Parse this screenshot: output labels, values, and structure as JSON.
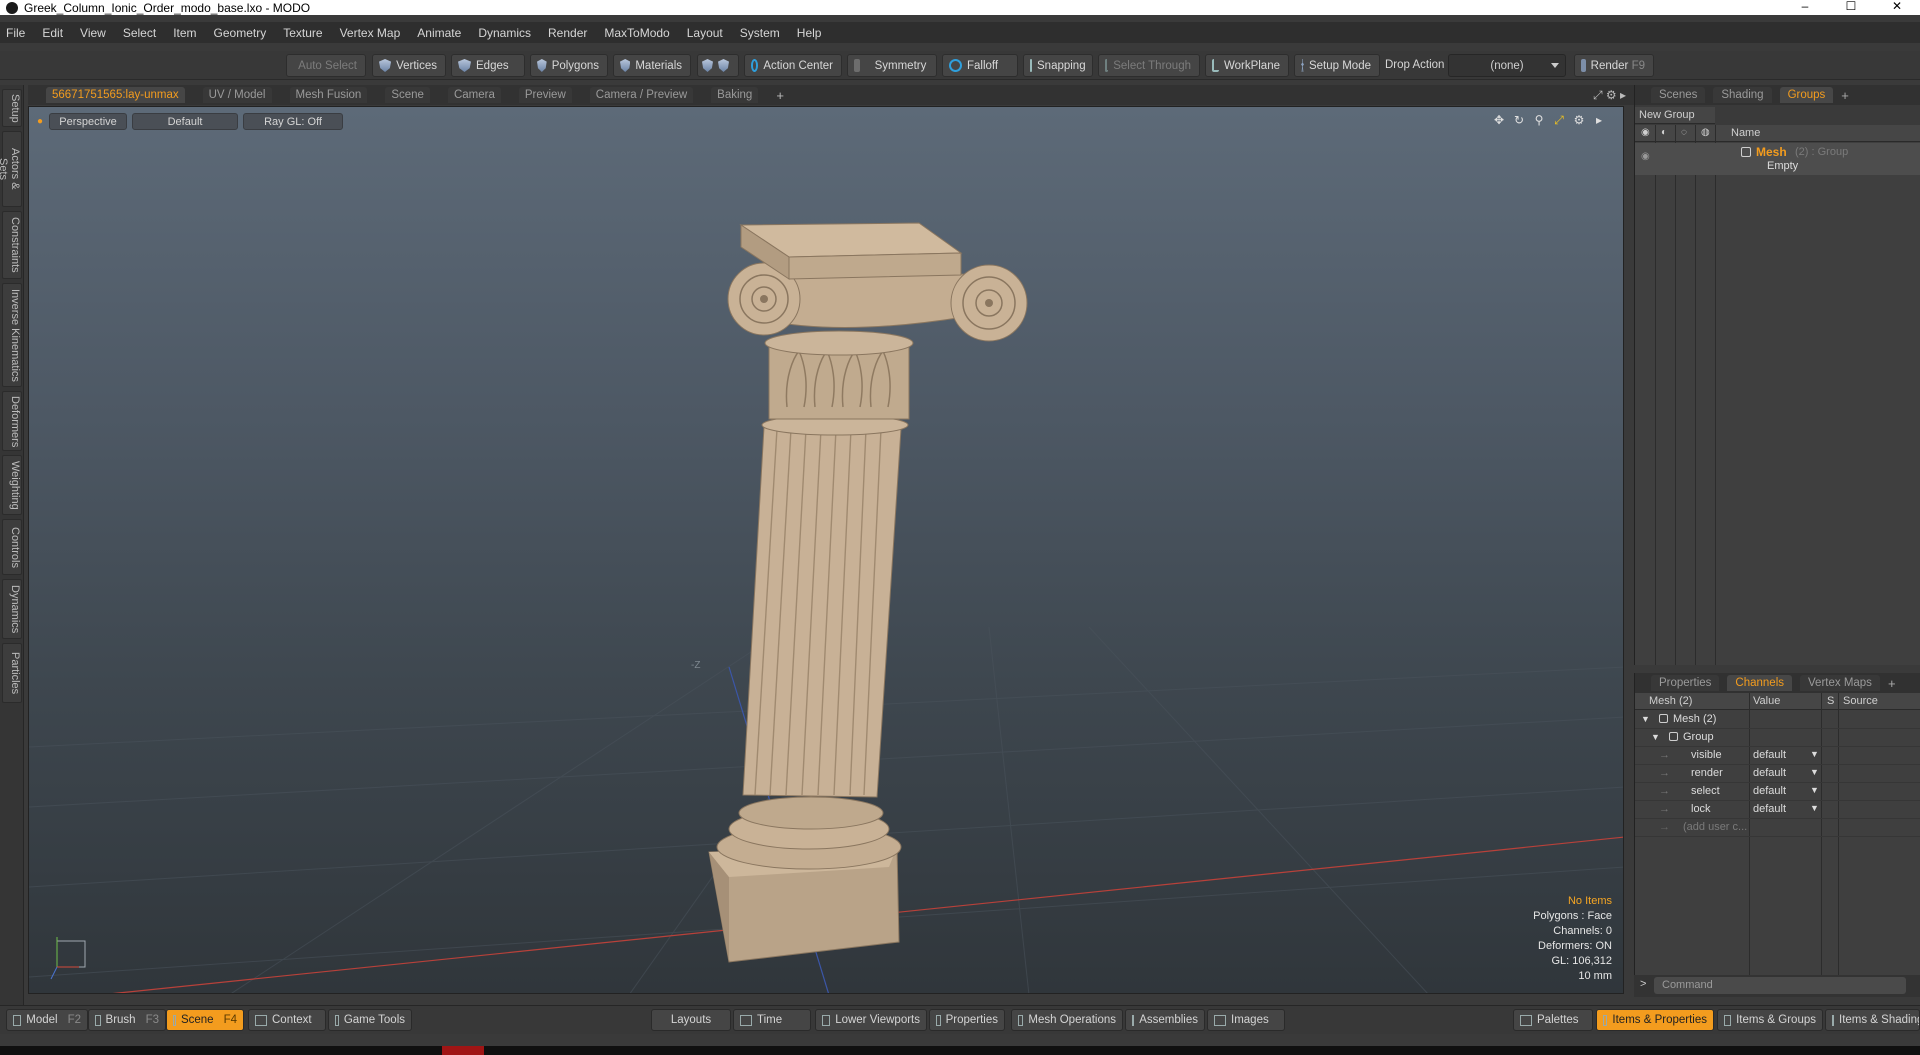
{
  "window": {
    "title": "Greek_Column_Ionic_Order_modo_base.lxo - MODO",
    "controls": [
      "–",
      "☐",
      "✕"
    ]
  },
  "menu": [
    "File",
    "Edit",
    "View",
    "Select",
    "Item",
    "Geometry",
    "Texture",
    "Vertex Map",
    "Animate",
    "Dynamics",
    "Render",
    "MaxToModo",
    "Layout",
    "System",
    "Help"
  ],
  "toolbar": {
    "auto_select": "Auto Select",
    "vertices": "Vertices",
    "edges": "Edges",
    "polygons": "Polygons",
    "materials": "Materials",
    "action_center": "Action Center",
    "symmetry": "Symmetry",
    "falloff": "Falloff",
    "snapping": "Snapping",
    "select_through": "Select Through",
    "workplane": "WorkPlane",
    "setup_mode": "Setup Mode",
    "drop_action_label": "Drop Action",
    "drop_action_value": "(none)",
    "render": "Render",
    "render_key": "F9"
  },
  "left_tabs": [
    "Setup",
    "Actors & Sets",
    "Constraints",
    "Inverse Kinematics",
    "Deformers",
    "Weighting",
    "Controls",
    "Dynamics",
    "Particles"
  ],
  "viewport_tabs": {
    "items": [
      "56671751565:lay-unmax",
      "UV / Model",
      "Mesh Fusion",
      "Scene",
      "Camera",
      "Preview",
      "Camera / Preview",
      "Baking"
    ],
    "active": "56671751565:lay-unmax",
    "add": "+"
  },
  "viewport": {
    "view": "Perspective",
    "shading": "Default",
    "raygl": "Ray GL: Off",
    "axis_z_label": "-Z",
    "info": {
      "items": "No Items",
      "polygons": "Polygons : Face",
      "channels": "Channels: 0",
      "deformers": "Deformers: ON",
      "gl": "GL: 106,312",
      "scale": "10 mm"
    }
  },
  "groups_panel": {
    "tabs": [
      "Scenes",
      "Shading",
      "Groups"
    ],
    "active": "Groups",
    "add": "+",
    "new_group": "New Group",
    "name_header": "Name",
    "item_name": "Mesh",
    "item_count": "(2) : Group",
    "item_sub": "Empty"
  },
  "channels_panel": {
    "tabs": [
      "Properties",
      "Channels",
      "Vertex Maps"
    ],
    "active": "Channels",
    "add": "+",
    "headers": [
      "Mesh (2)",
      "Value",
      "S",
      "Source"
    ],
    "tree_mesh": "Mesh (2)",
    "tree_group": "Group",
    "rows": [
      {
        "name": "visible",
        "value": "default"
      },
      {
        "name": "render",
        "value": "default"
      },
      {
        "name": "select",
        "value": "default"
      },
      {
        "name": "lock",
        "value": "default"
      }
    ],
    "add_user": "(add user c..."
  },
  "command": {
    "prompt": ">",
    "placeholder": "Command"
  },
  "bottom_bar": {
    "model": "Model",
    "model_key": "F2",
    "brush": "Brush",
    "brush_key": "F3",
    "scene": "Scene",
    "scene_key": "F4",
    "context": "Context",
    "game_tools": "Game Tools",
    "layouts": "Layouts",
    "time": "Time",
    "lower_viewports": "Lower Viewports",
    "properties": "Properties",
    "mesh_operations": "Mesh Operations",
    "assemblies": "Assemblies",
    "images": "Images",
    "palettes": "Palettes",
    "items_properties": "Items & Properties",
    "items_groups": "Items & Groups",
    "items_shading": "Items & Shading"
  },
  "colors": {
    "accent": "#f39c1e",
    "stone": "#c8b196",
    "background": "#3a3a3a"
  }
}
